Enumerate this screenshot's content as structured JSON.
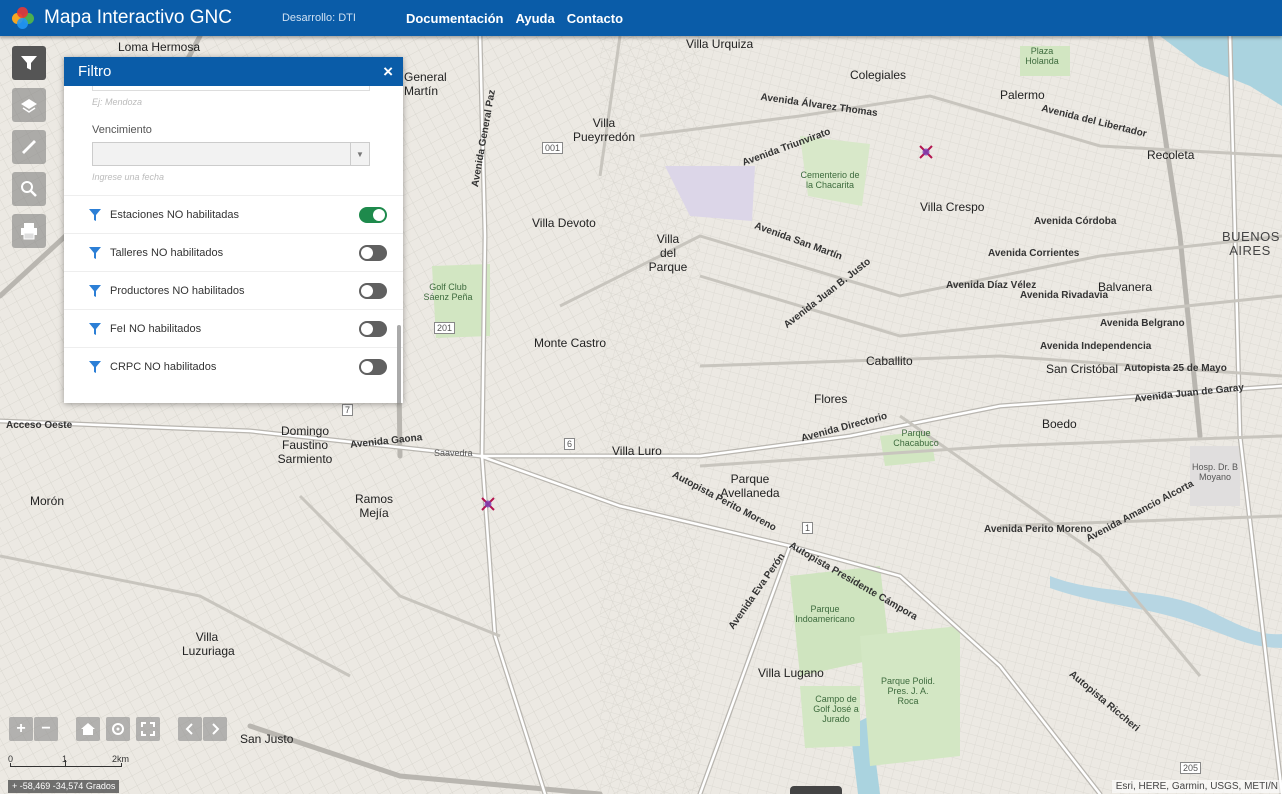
{
  "header": {
    "title": "Mapa Interactivo GNC",
    "environment": "Desarrollo: DTI",
    "nav": [
      "Documentación",
      "Ayuda",
      "Contacto"
    ]
  },
  "filter_panel": {
    "title": "Filtro",
    "close": "×",
    "top_hint": "Ej: Mendoza",
    "expiry_label": "Vencimiento",
    "expiry_hint": "Ingrese una fecha",
    "toggles": [
      {
        "label": "Estaciones NO habilitadas",
        "on": true
      },
      {
        "label": "Talleres NO habilitados",
        "on": false
      },
      {
        "label": "Productores NO habilitados",
        "on": false
      },
      {
        "label": "FeI NO habilitados",
        "on": false
      },
      {
        "label": "CRPC NO habilitados",
        "on": false
      }
    ]
  },
  "map_labels": {
    "neighborhoods": [
      "Loma Hermosa",
      "Villa Urquiza",
      "Colegiales",
      "Palermo",
      "Recoleta",
      "Villa Pueyrredón",
      "Villa Crespo",
      "Villa Devoto",
      "Villa del Parque",
      "Monte Castro",
      "Caballito",
      "Balvanera",
      "San Cristóbal",
      "Flores",
      "Boedo",
      "Villa Luro",
      "Domingo Faustino Sarmiento",
      "Parque Avellaneda",
      "Ramos Mejía",
      "Morón",
      "Villa Luzuriaga",
      "San Justo",
      "Villa Lugano",
      "BUENOS AIRES",
      "General Martín",
      "Saavedra"
    ],
    "roads": [
      "Avenida General Paz",
      "Avenida Rivadavia",
      "Avenida San Martín",
      "Avenida Córdoba",
      "Avenida Corrientes",
      "Avenida Díaz Vélez",
      "Avenida Belgrano",
      "Avenida Independencia",
      "Autopista 25 de Mayo",
      "Autopista Perito Moreno",
      "Avenida Directorio",
      "Avenida Eva Perón",
      "Avenida Triunvirato",
      "Avenida Álvarez Thomas",
      "Avenida del Libertador",
      "Avenida Juan B. Justo",
      "Autopista Presidente Cámpora",
      "Avenida Perito Moreno",
      "Acceso Oeste",
      "Avenida Gaona",
      "Avenida Amancio Alcorta",
      "Avenida Juan de Garay",
      "Autopista Riccheri"
    ],
    "parks": [
      "Cementerio de la Chacarita",
      "Golf Club Sáenz Peña",
      "Parque Indoamericano",
      "Campo de Golf José a Jurado",
      "Parque Polid. Pres. J. A. Roca",
      "Plaza Holanda",
      "Parque Chacabuco",
      "Hosp. Dr. B Moyano"
    ],
    "route_shields": [
      "001",
      "201",
      "7",
      "6",
      "1",
      "205"
    ]
  },
  "map_controls": {
    "zoom_in": "+",
    "zoom_out": "−",
    "scale": {
      "zero": "0",
      "one": "1",
      "two": "2km"
    },
    "coordinates": "-58,469 -34,574 Grados",
    "attribution": "Esri, HERE, Garmin, USGS, METI/N"
  }
}
